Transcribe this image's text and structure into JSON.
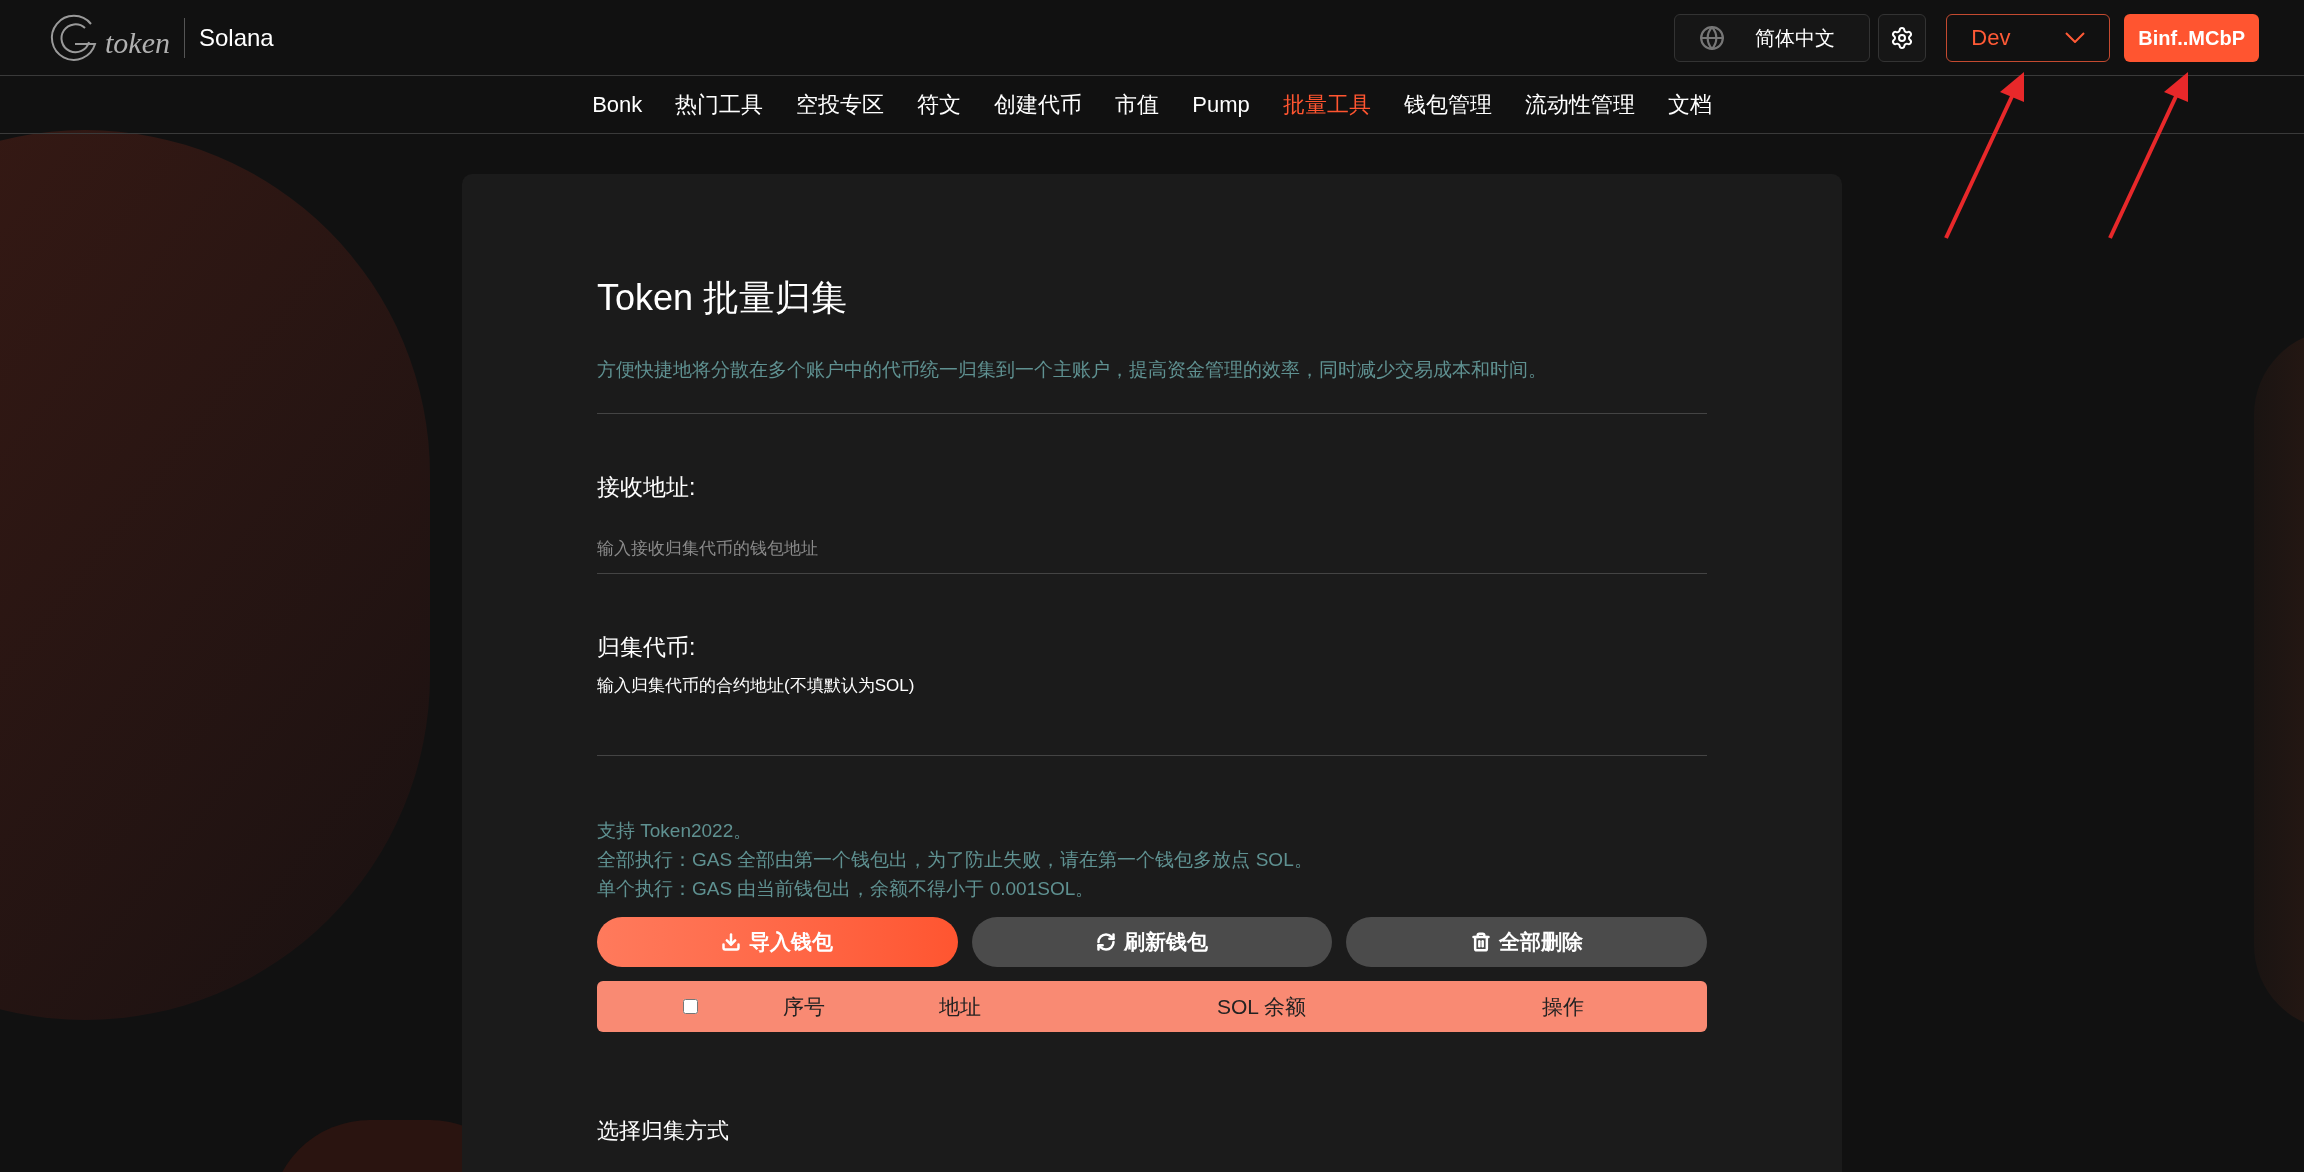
{
  "header": {
    "logo_text": "token",
    "network": "Solana",
    "language": "简体中文",
    "env_select": {
      "value": "Dev"
    },
    "wallet_button": "Binf..MCbP"
  },
  "nav": [
    {
      "label": "Bonk",
      "selected": false
    },
    {
      "label": "热门工具",
      "selected": false
    },
    {
      "label": "空投专区",
      "selected": false
    },
    {
      "label": "符文",
      "selected": false
    },
    {
      "label": "创建代币",
      "selected": false
    },
    {
      "label": "市值",
      "selected": false
    },
    {
      "label": "Pump",
      "selected": false
    },
    {
      "label": "批量工具",
      "selected": true
    },
    {
      "label": "钱包管理",
      "selected": false
    },
    {
      "label": "流动性管理",
      "selected": false
    },
    {
      "label": "文档",
      "selected": false
    }
  ],
  "page": {
    "title": "Token 批量归集",
    "description": "方便快捷地将分散在多个账户中的代币统一归集到一个主账户，提高资金管理的效率，同时减少交易成本和时间。",
    "receive": {
      "label": "接收地址:",
      "placeholder": "输入接收归集代币的钱包地址"
    },
    "token": {
      "label": "归集代币:",
      "hint": "输入归集代币的合约地址(不填默认为SOL)"
    },
    "notes": [
      "支持 Token2022。",
      "全部执行：GAS 全部由第一个钱包出，为了防止失败，请在第一个钱包多放点 SOL。",
      "单个执行：GAS 由当前钱包出，余额不得小于 0.001SOL。"
    ],
    "buttons": [
      {
        "label": "导入钱包",
        "kind": "import"
      },
      {
        "label": "刷新钱包",
        "kind": "refresh"
      },
      {
        "label": "全部删除",
        "kind": "delete"
      }
    ],
    "table": {
      "select_all": {
        "checked": false
      },
      "columns": [
        "序号",
        "地址",
        "SOL 余额",
        "操作"
      ]
    },
    "method_label": "选择归集方式"
  }
}
